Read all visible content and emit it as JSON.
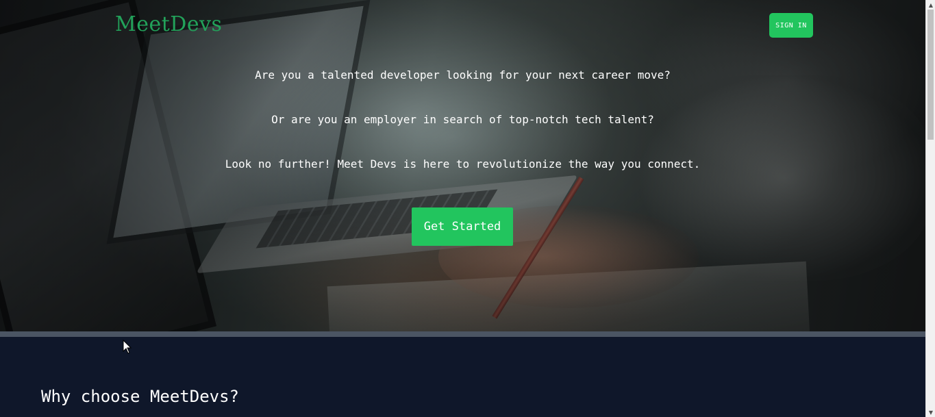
{
  "header": {
    "logo": "MeetDevs",
    "signin_label": "SIGN IN"
  },
  "hero": {
    "line1": "Are you a talented developer looking for your next career move?",
    "line2": "Or are you an employer in search of top-notch tech talent?",
    "line3": "Look no further! Meet Devs is here to revolutionize the way you connect.",
    "cta_label": "Get Started"
  },
  "why": {
    "title": "Why choose MeetDevs?"
  },
  "scrollbar": {
    "up_icon": "▲",
    "down_icon": "▼"
  },
  "colors": {
    "accent": "#22c55e",
    "logo": "#22a25a",
    "section_bg": "#0f172a",
    "divider": "#4b5563"
  }
}
